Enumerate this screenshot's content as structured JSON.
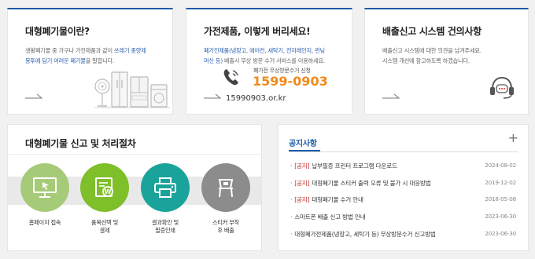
{
  "card1": {
    "title": "대형폐기물이란?",
    "desc_line1_pre": "생활폐기물 중 가구나 가전제품과 같이 ",
    "desc_line1_hl": "쓰레기 종량제",
    "desc_line2_hl": "봉투에 담기 어려운 폐기물",
    "desc_line2_post": "을 말합니다."
  },
  "card2": {
    "title": "가전제품, 이렇게 버리세요!",
    "desc_line1": "폐가전제품(냉장고, 에어컨, 세탁기, 전자레인지, 런닝",
    "desc_line2_hl": "머신 등)",
    "desc_line2_post": " 배출시 무상 방문 수거 서비스를 이용하세요.",
    "phone_label": "폐가전 무상방문수거 신청",
    "phone_number": "1599-0903",
    "site": "15990903.or.kr"
  },
  "card3": {
    "title": "배출신고 시스템 건의사항",
    "desc_line1": "배출신고 시스템에 대한 의견을 남겨주세요.",
    "desc_line2": "시스템 개선에 참고하도록 하겠습니다."
  },
  "procedure": {
    "title": "대형폐기물 신고 및 처리절차",
    "steps": [
      {
        "line1": "홈페이지 접속",
        "line2": "",
        "color": "#a6cb78"
      },
      {
        "line1": "품목선택 및",
        "line2": "결제",
        "color": "#7fbf2a"
      },
      {
        "line1": "결과확인 및",
        "line2": "필증인쇄",
        "color": "#1aa39a"
      },
      {
        "line1": "스티커 부착",
        "line2": "후 배출",
        "color": "#8c8c8c"
      }
    ]
  },
  "notice": {
    "title": "공지사항",
    "plus": "+",
    "items": [
      {
        "tag": "[공지]",
        "text": "납부필증 프린터 프로그램 다운로드",
        "date": "2024-08-02"
      },
      {
        "tag": "[공지]",
        "text": "대형폐기물 스티커 출력 오류 및 불가 시 대응방법",
        "date": "2019-12-02"
      },
      {
        "tag": "[공지]",
        "text": "대형폐기물 수거 안내",
        "date": "2018-05-08"
      },
      {
        "tag": "",
        "text": "스마트폰 배출 신고 방법 안내",
        "date": "2023-06-30"
      },
      {
        "tag": "",
        "text": "대형폐가전제품(냉장고, 세탁기 등) 무상방문수거 신고방법",
        "date": "2023-06-30"
      }
    ]
  },
  "colors": {
    "accent": "#1d5da8",
    "phone": "#f08a1b",
    "notice_tag": "#c62828"
  }
}
